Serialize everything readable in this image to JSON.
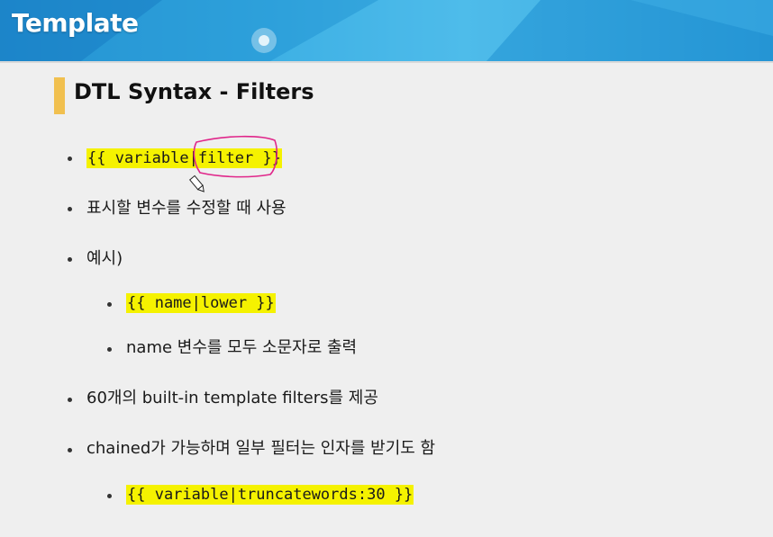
{
  "header": {
    "title": "Template"
  },
  "section": {
    "title": "DTL Syntax - Filters"
  },
  "bullets": [
    {
      "code": "{{ variable|filter }}"
    },
    {
      "text": "표시할 변수를 수정할 때 사용"
    },
    {
      "text": "예시)"
    },
    {
      "code": "{{ name|lower }}"
    },
    {
      "text": "name 변수를 모두 소문자로 출력"
    },
    {
      "text": "60개의 built-in template filters를 제공"
    },
    {
      "text": "chained가 가능하며 일부 필터는 인자를 받기도 함"
    },
    {
      "code": "{{ variable|truncatewords:30 }}"
    }
  ],
  "colors": {
    "highlight": "#f5f200",
    "section_bar": "#f1c04f",
    "annotation_pen": "#e0268a",
    "header": "#2fa7e0"
  }
}
